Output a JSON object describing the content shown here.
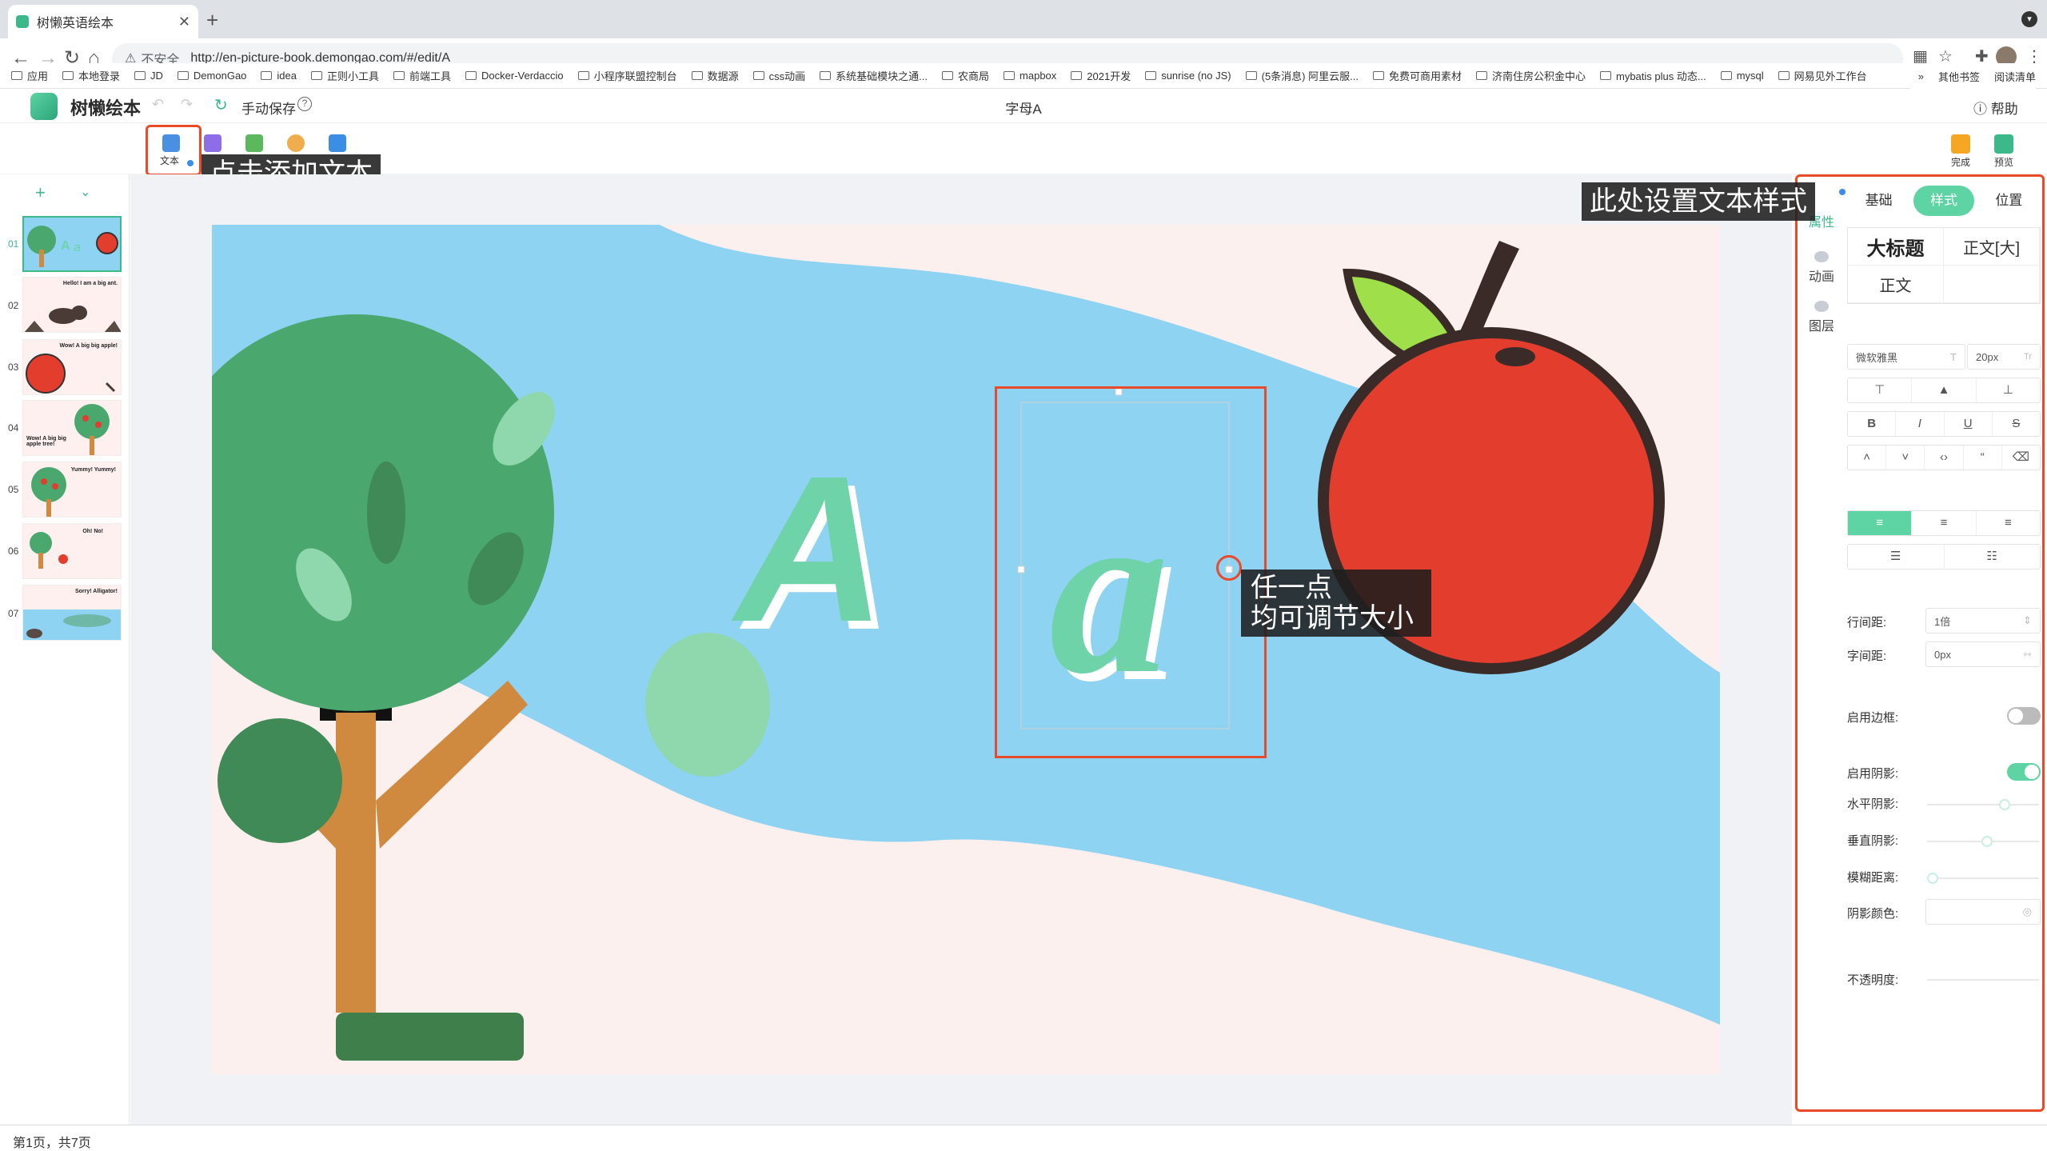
{
  "browser": {
    "tab_title": "树懒英语绘本",
    "insecure_label": "不安全",
    "url": "http://en-picture-book.demongao.com/#/edit/A",
    "bookmarks": [
      "应用",
      "本地登录",
      "JD",
      "DemonGao",
      "idea",
      "正则小工具",
      "前端工具",
      "Docker-Verdaccio",
      "小程序联盟控制台",
      "数据源",
      "css动画",
      "系统基础模块之通...",
      "农商局",
      "mapbox",
      "2021开发",
      "sunrise (no JS)",
      "(5条消息) 阿里云服...",
      "免费可商用素材",
      "济南住房公积金中心",
      "mybatis plus 动态...",
      "mysql",
      "网易见外工作台"
    ],
    "bookmarks_right": [
      "其他书签",
      "阅读清单"
    ]
  },
  "app": {
    "name": "树懒绘本",
    "save_mode": "手动保存",
    "doc_title": "字母A",
    "help": "帮助",
    "toolbar": {
      "text_label": "文本",
      "done_label": "完成",
      "preview_label": "预览"
    },
    "hint_add_text": "点击添加文本",
    "hint_style": "此处设置文本样式",
    "hint_resize_line1": "任一点",
    "hint_resize_line2": "均可调节大小"
  },
  "pages": {
    "items": [
      {
        "num": "01",
        "caption": ""
      },
      {
        "num": "02",
        "caption": "Hello! I am a big ant."
      },
      {
        "num": "03",
        "caption": "Wow! A big big apple!"
      },
      {
        "num": "04",
        "caption": "Wow! A big big apple tree!"
      },
      {
        "num": "05",
        "caption": "Yummy! Yummy!"
      },
      {
        "num": "06",
        "caption": "Oh! No!"
      },
      {
        "num": "07",
        "caption": "Sorry! Alligator!"
      }
    ],
    "status": "第1页，共7页"
  },
  "canvas": {
    "letter_upper": "A",
    "letter_lower": "a"
  },
  "panel": {
    "side_tabs": [
      "属性",
      "动画",
      "图层"
    ],
    "segments": [
      "基础",
      "样式",
      "位置"
    ],
    "active_segment": "样式",
    "presets": {
      "heading": "大标题",
      "body_large": "正文[大]",
      "body": "正文"
    },
    "font_name": "微软雅黑",
    "font_size": "20px",
    "line_height_label": "行间距:",
    "line_height_value": "1倍",
    "letter_spacing_label": "字间距:",
    "letter_spacing_value": "0px",
    "border_label": "启用边框:",
    "border_enabled": false,
    "shadow_label": "启用阴影:",
    "shadow_enabled": true,
    "h_shadow_label": "水平阴影:",
    "v_shadow_label": "垂直阴影:",
    "blur_label": "模糊距离:",
    "shadow_color_label": "阴影颜色:",
    "opacity_label": "不透明度:"
  },
  "colors": {
    "accent": "#5ed3a4",
    "highlight": "#e84a2a",
    "sky": "#8fd3f2",
    "tree": "#4aa86e",
    "apple": "#e23d2d"
  }
}
